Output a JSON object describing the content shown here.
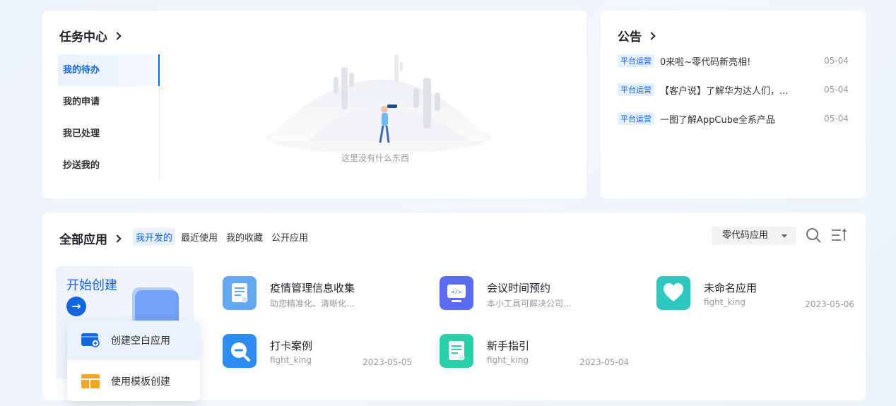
{
  "task_center": {
    "title": "任务中心",
    "tabs": [
      {
        "label": "我的待办",
        "active": true
      },
      {
        "label": "我的申请"
      },
      {
        "label": "我已处理"
      },
      {
        "label": "抄送我的"
      }
    ],
    "empty_text": "这里没有什么东西"
  },
  "notice": {
    "title": "公告",
    "items": [
      {
        "tag": "平台运营",
        "text": "0来啦~零代码新亮相!",
        "date": "05-04"
      },
      {
        "tag": "平台运营",
        "text": "【客户说】了解华为达人们，...",
        "date": "05-04"
      },
      {
        "tag": "平台运营",
        "text": "一图了解AppCube全系产品",
        "date": "05-04"
      }
    ]
  },
  "apps": {
    "title": "全部应用",
    "tabs": [
      {
        "label": "我开发的",
        "active": true
      },
      {
        "label": "最近使用"
      },
      {
        "label": "我的收藏"
      },
      {
        "label": "公开应用"
      }
    ],
    "filter": "零代码应用",
    "create_title": "开始创建",
    "list": [
      {
        "name": "疫情管理信息收集",
        "sub": "助您精准化、清晰化...",
        "date": "",
        "icon": "form-doc-icon",
        "color": "#64a8f5"
      },
      {
        "name": "会议时间预约",
        "sub": "本小工具可解决公司...",
        "date": "",
        "icon": "code-screen-icon",
        "color": "#5b6cf0"
      },
      {
        "name": "未命名应用",
        "sub": "fight_king",
        "date": "2023-05-06",
        "icon": "heart-icon",
        "color": "#2ec7c0"
      },
      {
        "name": "打卡案例",
        "sub": "fight_king",
        "date": "2023-05-05",
        "icon": "search-minus-icon",
        "color": "#2f8cf2"
      },
      {
        "name": "新手指引",
        "sub": "fight_king",
        "date": "2023-05-04",
        "icon": "guide-doc-icon",
        "color": "#2bcfa8"
      }
    ]
  },
  "popup": {
    "items": [
      "创建空白应用",
      "使用模板创建"
    ]
  },
  "colors": {
    "accent": "#1466e0",
    "tag_bg": "#e5f0ff"
  }
}
